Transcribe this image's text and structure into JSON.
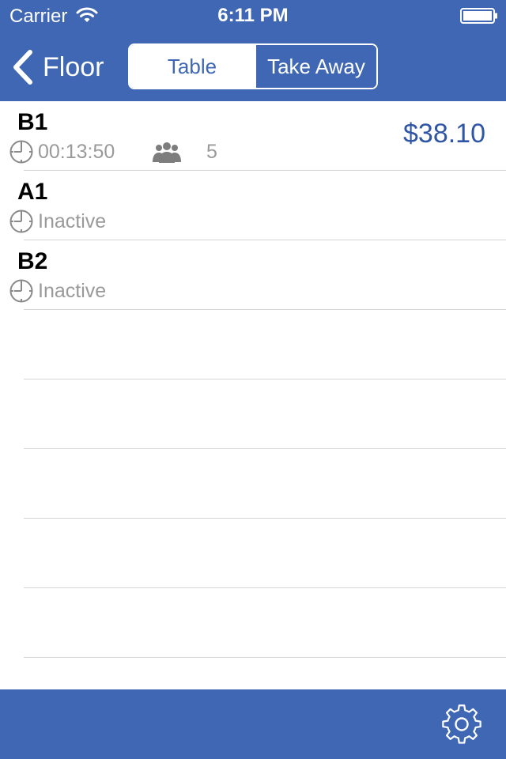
{
  "status_bar": {
    "carrier": "Carrier",
    "time": "6:11 PM",
    "icons": [
      "wifi-icon",
      "battery-icon"
    ]
  },
  "nav": {
    "back_label": "Floor",
    "segments": [
      "Table",
      "Take Away"
    ],
    "selected_segment": "Take Away"
  },
  "tables": [
    {
      "name": "B1",
      "status": "00:13:50",
      "guests": "5",
      "amount": "$38.10"
    },
    {
      "name": "A1",
      "status": "Inactive"
    },
    {
      "name": "B2",
      "status": "Inactive"
    }
  ],
  "toolbar": {
    "settings_icon": "gear-icon"
  },
  "colors": {
    "brand": "#3f67b3",
    "amount": "#2f56a5",
    "muted_text": "#9a9a9a",
    "separator": "#d6d6da"
  }
}
